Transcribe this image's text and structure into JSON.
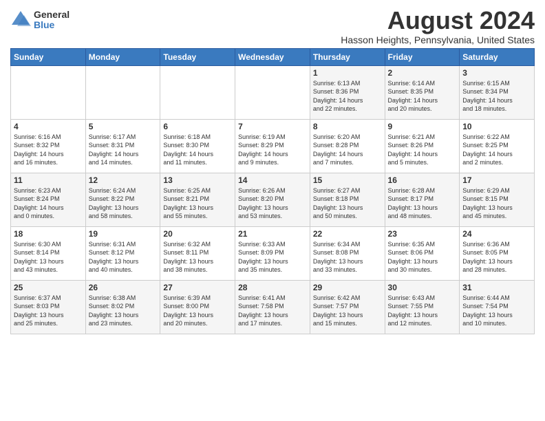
{
  "header": {
    "logo_general": "General",
    "logo_blue": "Blue",
    "title": "August 2024",
    "subtitle": "Hasson Heights, Pennsylvania, United States"
  },
  "days_of_week": [
    "Sunday",
    "Monday",
    "Tuesday",
    "Wednesday",
    "Thursday",
    "Friday",
    "Saturday"
  ],
  "weeks": [
    [
      {
        "day": "",
        "info": ""
      },
      {
        "day": "",
        "info": ""
      },
      {
        "day": "",
        "info": ""
      },
      {
        "day": "",
        "info": ""
      },
      {
        "day": "1",
        "info": "Sunrise: 6:13 AM\nSunset: 8:36 PM\nDaylight: 14 hours\nand 22 minutes."
      },
      {
        "day": "2",
        "info": "Sunrise: 6:14 AM\nSunset: 8:35 PM\nDaylight: 14 hours\nand 20 minutes."
      },
      {
        "day": "3",
        "info": "Sunrise: 6:15 AM\nSunset: 8:34 PM\nDaylight: 14 hours\nand 18 minutes."
      }
    ],
    [
      {
        "day": "4",
        "info": "Sunrise: 6:16 AM\nSunset: 8:32 PM\nDaylight: 14 hours\nand 16 minutes."
      },
      {
        "day": "5",
        "info": "Sunrise: 6:17 AM\nSunset: 8:31 PM\nDaylight: 14 hours\nand 14 minutes."
      },
      {
        "day": "6",
        "info": "Sunrise: 6:18 AM\nSunset: 8:30 PM\nDaylight: 14 hours\nand 11 minutes."
      },
      {
        "day": "7",
        "info": "Sunrise: 6:19 AM\nSunset: 8:29 PM\nDaylight: 14 hours\nand 9 minutes."
      },
      {
        "day": "8",
        "info": "Sunrise: 6:20 AM\nSunset: 8:28 PM\nDaylight: 14 hours\nand 7 minutes."
      },
      {
        "day": "9",
        "info": "Sunrise: 6:21 AM\nSunset: 8:26 PM\nDaylight: 14 hours\nand 5 minutes."
      },
      {
        "day": "10",
        "info": "Sunrise: 6:22 AM\nSunset: 8:25 PM\nDaylight: 14 hours\nand 2 minutes."
      }
    ],
    [
      {
        "day": "11",
        "info": "Sunrise: 6:23 AM\nSunset: 8:24 PM\nDaylight: 14 hours\nand 0 minutes."
      },
      {
        "day": "12",
        "info": "Sunrise: 6:24 AM\nSunset: 8:22 PM\nDaylight: 13 hours\nand 58 minutes."
      },
      {
        "day": "13",
        "info": "Sunrise: 6:25 AM\nSunset: 8:21 PM\nDaylight: 13 hours\nand 55 minutes."
      },
      {
        "day": "14",
        "info": "Sunrise: 6:26 AM\nSunset: 8:20 PM\nDaylight: 13 hours\nand 53 minutes."
      },
      {
        "day": "15",
        "info": "Sunrise: 6:27 AM\nSunset: 8:18 PM\nDaylight: 13 hours\nand 50 minutes."
      },
      {
        "day": "16",
        "info": "Sunrise: 6:28 AM\nSunset: 8:17 PM\nDaylight: 13 hours\nand 48 minutes."
      },
      {
        "day": "17",
        "info": "Sunrise: 6:29 AM\nSunset: 8:15 PM\nDaylight: 13 hours\nand 45 minutes."
      }
    ],
    [
      {
        "day": "18",
        "info": "Sunrise: 6:30 AM\nSunset: 8:14 PM\nDaylight: 13 hours\nand 43 minutes."
      },
      {
        "day": "19",
        "info": "Sunrise: 6:31 AM\nSunset: 8:12 PM\nDaylight: 13 hours\nand 40 minutes."
      },
      {
        "day": "20",
        "info": "Sunrise: 6:32 AM\nSunset: 8:11 PM\nDaylight: 13 hours\nand 38 minutes."
      },
      {
        "day": "21",
        "info": "Sunrise: 6:33 AM\nSunset: 8:09 PM\nDaylight: 13 hours\nand 35 minutes."
      },
      {
        "day": "22",
        "info": "Sunrise: 6:34 AM\nSunset: 8:08 PM\nDaylight: 13 hours\nand 33 minutes."
      },
      {
        "day": "23",
        "info": "Sunrise: 6:35 AM\nSunset: 8:06 PM\nDaylight: 13 hours\nand 30 minutes."
      },
      {
        "day": "24",
        "info": "Sunrise: 6:36 AM\nSunset: 8:05 PM\nDaylight: 13 hours\nand 28 minutes."
      }
    ],
    [
      {
        "day": "25",
        "info": "Sunrise: 6:37 AM\nSunset: 8:03 PM\nDaylight: 13 hours\nand 25 minutes."
      },
      {
        "day": "26",
        "info": "Sunrise: 6:38 AM\nSunset: 8:02 PM\nDaylight: 13 hours\nand 23 minutes."
      },
      {
        "day": "27",
        "info": "Sunrise: 6:39 AM\nSunset: 8:00 PM\nDaylight: 13 hours\nand 20 minutes."
      },
      {
        "day": "28",
        "info": "Sunrise: 6:41 AM\nSunset: 7:58 PM\nDaylight: 13 hours\nand 17 minutes."
      },
      {
        "day": "29",
        "info": "Sunrise: 6:42 AM\nSunset: 7:57 PM\nDaylight: 13 hours\nand 15 minutes."
      },
      {
        "day": "30",
        "info": "Sunrise: 6:43 AM\nSunset: 7:55 PM\nDaylight: 13 hours\nand 12 minutes."
      },
      {
        "day": "31",
        "info": "Sunrise: 6:44 AM\nSunset: 7:54 PM\nDaylight: 13 hours\nand 10 minutes."
      }
    ]
  ]
}
